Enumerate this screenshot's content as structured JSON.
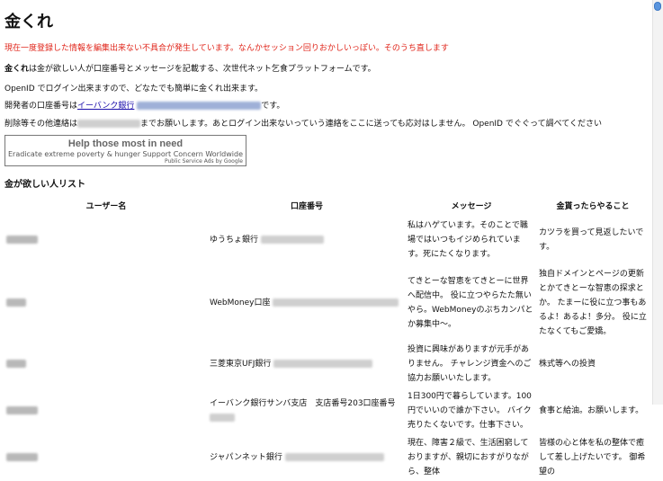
{
  "header": {
    "title": "金くれ"
  },
  "notice": "現在一度登録した情報を編集出来ない不具合が発生しています。なんかセッション回りおかしいっぽい。そのうち直します",
  "intro": {
    "brand": "金くれ",
    "line1_rest": "は金が欲しい人が口座番号とメッセージを記載する、次世代ネット乞食プラットフォームです。",
    "line2": "OpenID でログイン出来ますので、どなたでも簡単に金くれ出来ます。",
    "line3_prefix": "開発者の口座番号は",
    "line3_bank_link": "イーバンク銀行",
    "line3_suffix": "です。",
    "line4_prefix": "削除等その他連絡は",
    "line4_suffix": "までお願いします。あとログイン出来ないっていう連絡をここに送っても応対はしません。 OpenID でぐぐって調べてください"
  },
  "ad": {
    "title": "Help those most in need",
    "subtitle": "Eradicate extreme poverty & hunger Support Concern Worldwide",
    "attribution": "Public Service Ads by Google"
  },
  "list": {
    "heading": "金が欲しい人リスト",
    "columns": [
      "ユーザー名",
      "口座番号",
      "メッセージ",
      "金貰ったらやること"
    ],
    "rows": [
      {
        "bank": "ゆうちょ銀行",
        "message": "私はハゲています。そのことで職場ではいつもイジめられています。死にたくなります。",
        "plan": "カツラを買って見返したいです。"
      },
      {
        "bank": "WebMoney口座",
        "message": "てきとーな智恵をてきとーに世界へ配信中。 役に立つやらたた無いやら。WebMoneyのぷちカンパとか募集中～。",
        "plan": "独自ドメインとページの更新とかてきとーな智恵の探求とか。 たまーに役に立つ事もあるよ！あるよ！多分。 役に立たなくてもご愛嬌。"
      },
      {
        "bank": "三菱東京UFJ銀行",
        "message": "投資に興味がありますが元手がありません。 チャレンジ資金へのご協力お願いいたします。",
        "plan": "株式等への投資"
      },
      {
        "bank": "イーバンク銀行サンバ支店　支店番号203口座番号",
        "message": "1日300円で暮らしています。100円でいいので誰か下さい。 バイク売りたくないです。仕事下さい。",
        "plan": "食事と給油。お願いします。"
      },
      {
        "bank": "ジャパンネット銀行",
        "message": "現在、障害２級で、生活困窮しておりますが、親切におすがりながら、整体",
        "plan": "皆様の心と体を私の整体で癒して差し上げたいです。 御希望の"
      }
    ]
  }
}
